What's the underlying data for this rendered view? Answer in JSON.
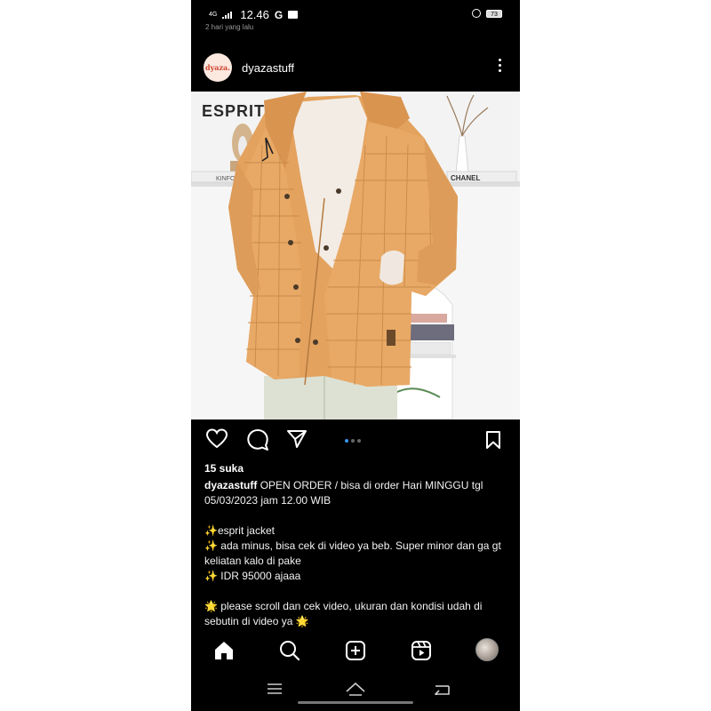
{
  "status_bar": {
    "network": "4G",
    "time": "12.46",
    "g_label": "G",
    "battery": "73"
  },
  "previous_post_caption": "2 hari yang lalu",
  "post": {
    "avatar_text": "dyaza.",
    "username": "dyazastuff",
    "photo": {
      "brand_logo": "ESPRIT",
      "book_label": "CHANEL",
      "shelf_book": "KINFO"
    },
    "carousel": {
      "count": 3,
      "active": 0
    },
    "likes": "15 suka",
    "caption": {
      "username": "dyazastuff",
      "lines": [
        "OPEN ORDER / bisa di order Hari MINGGU tgl 05/03/2023 jam 12.00 WIB",
        "",
        "✨esprit jacket",
        "✨ ada minus, bisa cek di video ya beb. Super minor dan ga gt keliatan kalo di pake",
        "✨ IDR 95000 ajaaa",
        "",
        "🌟 please scroll dan cek video, ukuran dan kondisi udah di sebutin di video ya 🌟"
      ]
    }
  },
  "bottom_nav": [
    "home-icon",
    "search-icon",
    "create-icon",
    "reels-icon",
    "profile-avatar"
  ],
  "colors": {
    "background": "#000000",
    "jacket": "#e3a25e",
    "carousel_active": "#3897f0"
  }
}
